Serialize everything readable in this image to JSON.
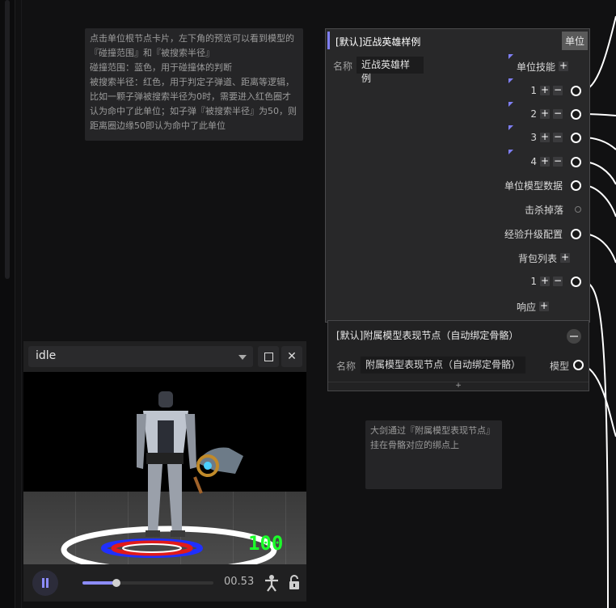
{
  "note_top": {
    "text": "点击单位根节点卡片，左下角的预览可以看到模型的『碰撞范围』和『被搜索半径』\n碰撞范围：蓝色，用于碰撞体的判断\n被搜索半径：红色，用于判定子弹道、距离等逻辑，比如一颗子弹被搜索半径为0时，需要进入红色圈才认为命中了此单位；如子弹『被搜索半径』为50，则距离圈边缘50即认为命中了此单位"
  },
  "note_bottom": {
    "text": "大剑通过『附属模型表现节点』挂在骨骼对应的绑点上"
  },
  "unit_node": {
    "title": "[默认]近战英雄样例",
    "type_badge": "单位",
    "name_label": "名称",
    "name_value": "近战英雄样例",
    "skills_label": "单位技能",
    "skills": [
      "1",
      "2",
      "3",
      "4"
    ],
    "model_data": "单位模型数据",
    "kill_drop": "击杀掉落",
    "exp_config": "经验升级配置",
    "backpack": "背包列表",
    "backpack_items": [
      "1"
    ],
    "response": "响应",
    "accent": "#7f7ff5"
  },
  "attach_node": {
    "title": "[默认]附属模型表现节点（自动绑定骨骼）",
    "name_label": "名称",
    "name_value": "附属模型表现节点（自动绑定骨骼）",
    "model_label": "模型",
    "add_label": "+"
  },
  "preview": {
    "animation": "idle",
    "hp": "100",
    "progress": 0.26,
    "time": "00.53",
    "icons": [
      "pause-icon",
      "maximize-icon",
      "close-icon",
      "humanoid-icon",
      "lock-icon"
    ]
  }
}
